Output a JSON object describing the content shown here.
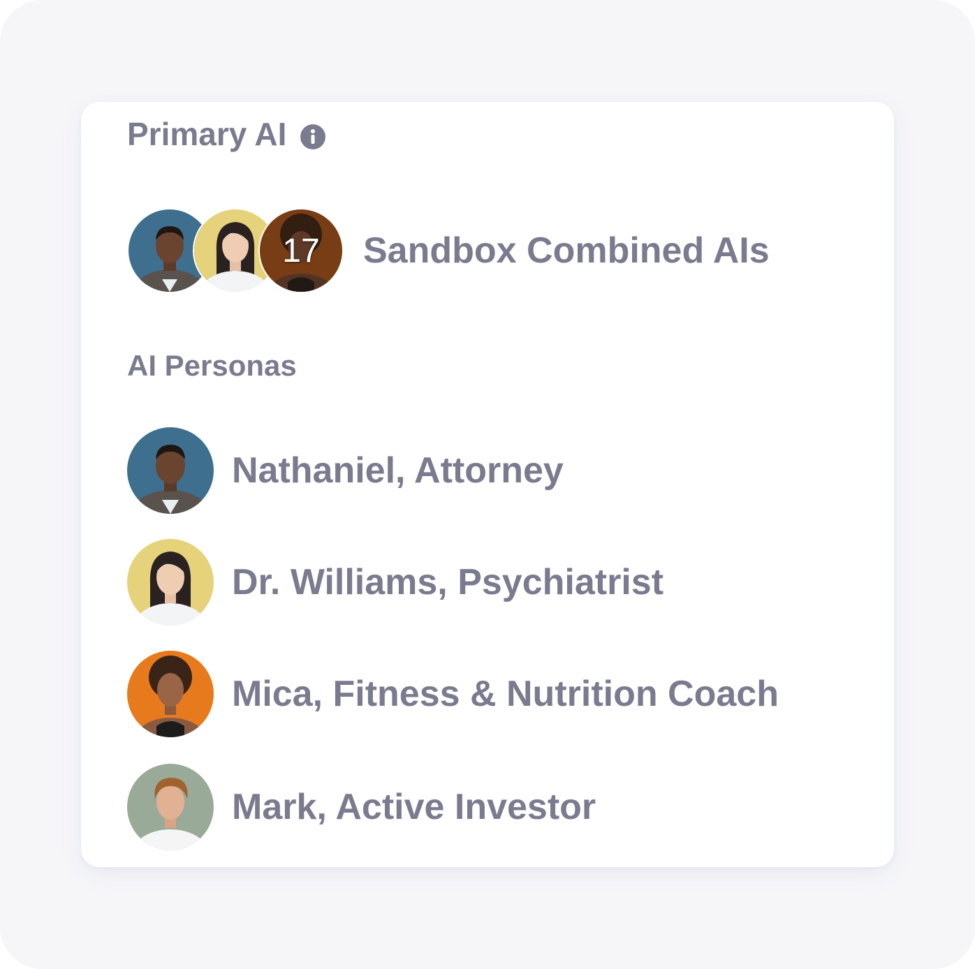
{
  "primary": {
    "label": "Primary AI",
    "info_icon": "info-circle-icon",
    "combined_name": "Sandbox Combined AIs",
    "combined_count": "17"
  },
  "personas": {
    "label": "AI Personas",
    "items": [
      {
        "name": "Nathaniel, Attorney",
        "avatar_bg": "#3f6f8f"
      },
      {
        "name": "Dr. Williams, Psychiatrist",
        "avatar_bg": "#e5d27a"
      },
      {
        "name": "Mica, Fitness & Nutrition Coach",
        "avatar_bg": "#e87a1e"
      },
      {
        "name": "Mark, Active Investor",
        "avatar_bg": "#9aaa98"
      }
    ]
  },
  "colors": {
    "text": "#7a7b8f",
    "card": "#ffffff",
    "background": "#f6f6f9"
  }
}
